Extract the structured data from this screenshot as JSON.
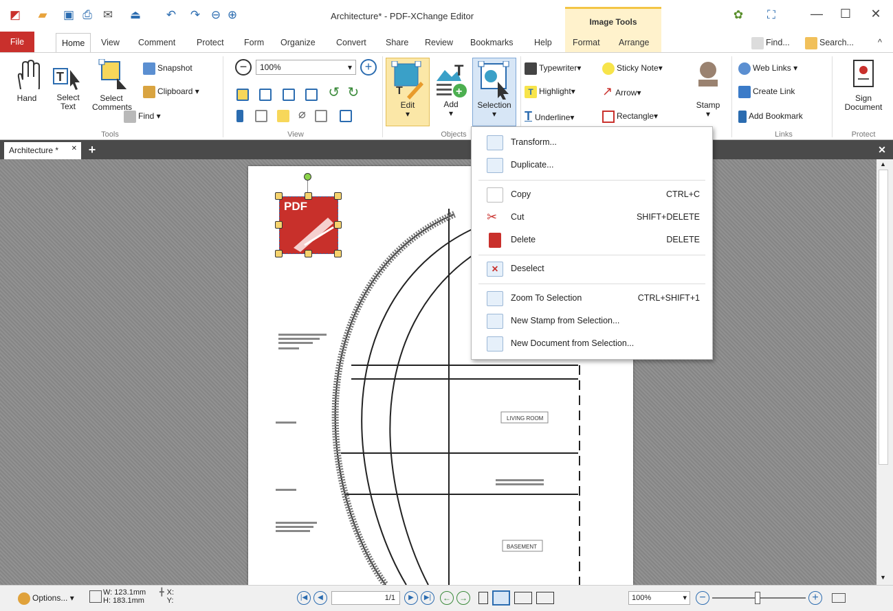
{
  "window": {
    "title": "Architecture* - PDF-XChange Editor",
    "context_tab": "Image Tools"
  },
  "tabs": [
    "Home",
    "View",
    "Comment",
    "Protect",
    "Form",
    "Organize",
    "Convert",
    "Share",
    "Review",
    "Bookmarks",
    "Help"
  ],
  "file_tab": "File",
  "context_tabs": [
    "Format",
    "Arrange"
  ],
  "right_tools": {
    "find": "Find...",
    "search": "Search..."
  },
  "ribbon": {
    "tools": {
      "hand": "Hand",
      "select_text": "Select Text",
      "select_comments": "Select Comments",
      "snapshot": "Snapshot",
      "clipboard": "Clipboard",
      "find": "Find",
      "group": "Tools"
    },
    "view": {
      "zoom": "100%",
      "group": "View"
    },
    "objects": {
      "edit": "Edit",
      "add": "Add",
      "selection": "Selection",
      "group": "Objects"
    },
    "comment": {
      "typewriter": "Typewriter",
      "sticky_note": "Sticky Note",
      "highlight": "Highlight",
      "arrow": "Arrow",
      "underline": "Underline",
      "rectangle": "Rectangle",
      "stamp": "Stamp"
    },
    "links": {
      "web_links": "Web Links",
      "create_link": "Create Link",
      "add_bookmark": "Add Bookmark",
      "group": "Links"
    },
    "protect": {
      "sign_document": "Sign Document",
      "group": "Protect"
    }
  },
  "doc_tab": "Architecture *",
  "menu": {
    "items": [
      {
        "label": "Transform...",
        "shortcut": ""
      },
      {
        "label": "Duplicate...",
        "shortcut": ""
      },
      {
        "label": "Copy",
        "shortcut": "CTRL+C"
      },
      {
        "label": "Cut",
        "shortcut": "SHIFT+DELETE"
      },
      {
        "label": "Delete",
        "shortcut": "DELETE"
      },
      {
        "label": "Deselect",
        "shortcut": ""
      },
      {
        "label": "Zoom To Selection",
        "shortcut": "CTRL+SHIFT+1"
      },
      {
        "label": "New Stamp from Selection...",
        "shortcut": ""
      },
      {
        "label": "New Document from Selection...",
        "shortcut": ""
      }
    ]
  },
  "page_content": {
    "logo_text": "PDF",
    "living_room": "LIVING ROOM",
    "basement": "BASEMENT"
  },
  "status": {
    "options": "Options...",
    "width": "W: 123.1mm",
    "height": "H: 183.1mm",
    "x": "X:",
    "y": "Y:",
    "page": "1/1",
    "zoom": "100%"
  },
  "colors": {
    "file_tab": "#c9302c",
    "context": "#fff2cc",
    "accent": "#f3c544"
  }
}
